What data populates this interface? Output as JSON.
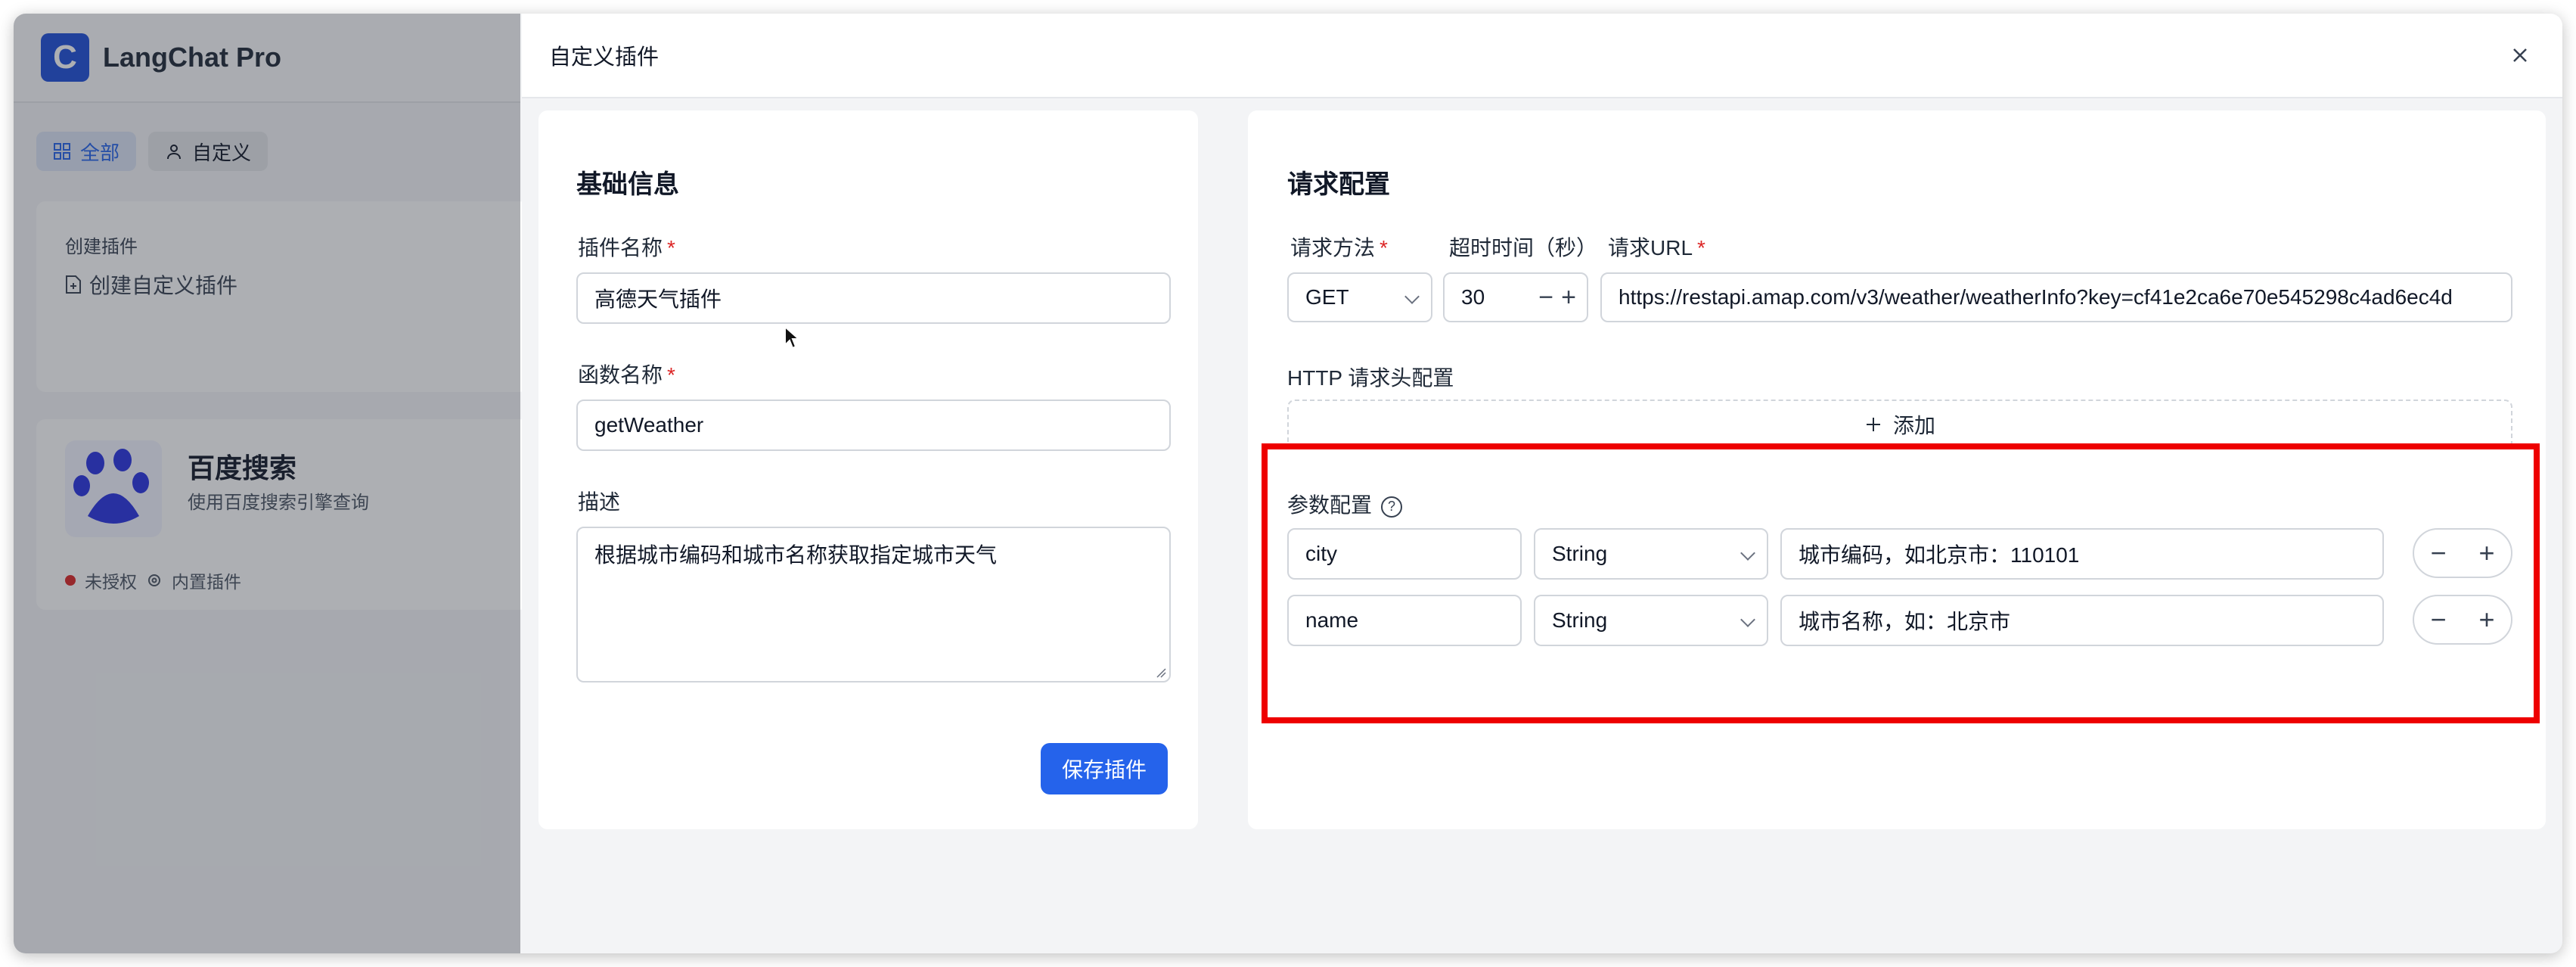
{
  "app": {
    "brand_letter": "C",
    "brand": "LangChat Pro",
    "tabs": [
      {
        "label": "全部"
      },
      {
        "label": "自定义"
      }
    ],
    "create_card": {
      "title": "创建插件",
      "link": "创建自定义插件"
    },
    "plugin_card": {
      "name": "百度搜索",
      "description": "使用百度搜索引擎查询",
      "status": "未授权",
      "tag": "内置插件"
    }
  },
  "drawer": {
    "title": "自定义插件",
    "basic": {
      "section_title": "基础信息",
      "plugin_name_label": "插件名称",
      "plugin_name_value": "高德天气插件",
      "function_name_label": "函数名称",
      "function_name_value": "getWeather",
      "description_label": "描述",
      "description_value": "根据城市编码和城市名称获取指定城市天气",
      "save_label": "保存插件"
    },
    "request": {
      "section_title": "请求配置",
      "method_label": "请求方法",
      "method_value": "GET",
      "timeout_label": "超时时间（秒）",
      "timeout_value": "30",
      "url_label": "请求URL",
      "url_value": "https://restapi.amap.com/v3/weather/weatherInfo?key=cf41e2ca6e70e545298c4ad6ec4d",
      "headers_label": "HTTP 请求头配置",
      "add_label": "添加",
      "params_label": "参数配置",
      "params": [
        {
          "name": "city",
          "type": "String",
          "description": "城市编码，如北京市：110101"
        },
        {
          "name": "name",
          "type": "String",
          "description": "城市名称，如：北京市"
        }
      ]
    }
  },
  "colors": {
    "primary": "#2563eb",
    "required": "#dc2626",
    "highlight": "#ee0000"
  }
}
